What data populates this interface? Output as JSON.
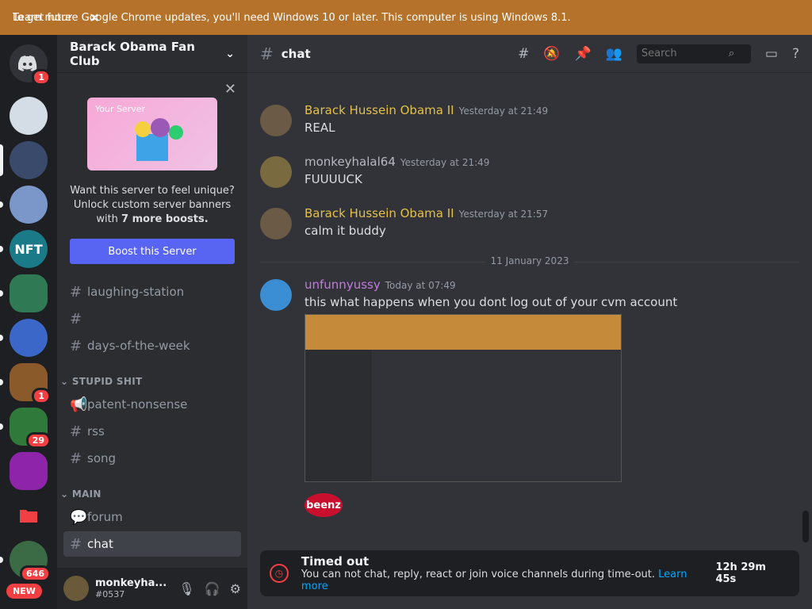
{
  "banner": {
    "message": "To get future Google Chrome updates, you'll need Windows 10 or later. This computer is using Windows 8.1.",
    "learn_more": "Learn more",
    "close": "✕"
  },
  "servers": {
    "home_badge": "1",
    "items": [
      {
        "name": "server-1",
        "color": "#d4dde6"
      },
      {
        "name": "server-obama",
        "color": "#3a4a6b"
      },
      {
        "name": "server-3",
        "color": "#7b96c8"
      },
      {
        "name": "server-nft",
        "color": "#1a7a88"
      },
      {
        "name": "server-5",
        "color": "#2f7a55"
      },
      {
        "name": "server-6",
        "color": "#3b67c9"
      },
      {
        "name": "server-7",
        "color": "#8b5a2b",
        "badge": "1"
      },
      {
        "name": "server-8",
        "color": "#2f7a3a",
        "badge": "29"
      },
      {
        "name": "server-9",
        "color": "#8e24aa"
      },
      {
        "name": "server-10",
        "color": "#2b2d31"
      },
      {
        "name": "server-11",
        "color": "#3a6b45",
        "badge": "646"
      }
    ],
    "new_badge": "NEW"
  },
  "sidebar": {
    "server_name": "Barack Obama Fan Club",
    "boost_art_label": "Your Server",
    "boost_text_1": "Want this server to feel unique? Unlock custom server banners with ",
    "boost_text_bold": "7 more boosts.",
    "boost_button": "Boost this Server",
    "channels_top": [
      {
        "label": "laughing-station"
      },
      {
        "label": ""
      },
      {
        "label": "days-of-the-week"
      }
    ],
    "category_1": "STUPID SHIT",
    "channels_cat1": [
      {
        "label": "patent-nonsense",
        "icon": "📢"
      },
      {
        "label": "rss",
        "icon": "#"
      },
      {
        "label": "song",
        "icon": "#"
      }
    ],
    "category_2": "MAIN",
    "channels_cat2": [
      {
        "label": "forum",
        "icon": "💬"
      },
      {
        "label": "chat",
        "icon": "#"
      }
    ],
    "user": {
      "name": "monkeyha...",
      "tag": "#0537"
    }
  },
  "main": {
    "channel": "chat",
    "search_placeholder": "Search",
    "messages": [
      {
        "author": "Barack Hussein Obama II",
        "time": "Yesterday at 21:49",
        "text": "REAL",
        "color": "#e3c04a"
      },
      {
        "author": "monkeyhalal64",
        "time": "Yesterday at 21:49",
        "text": "FUUUUCK",
        "color": "#b5bac1"
      },
      {
        "author": "Barack Hussein Obama II",
        "time": "Yesterday at 21:57",
        "text": "calm it buddy",
        "color": "#e3c04a"
      },
      {
        "author": "unfunnyussy",
        "time": "Today at 07:49",
        "text": "this what happens when you dont log out of your cvm account",
        "color": "#c27bde"
      }
    ],
    "date_divider": "11 January 2023",
    "sticker_text": "beenz",
    "timeout": {
      "title": "Timed out",
      "text": "You can not chat, reply, react or join voice channels during time-out.",
      "link": "Learn more",
      "timer": "12h 29m 45s"
    }
  }
}
